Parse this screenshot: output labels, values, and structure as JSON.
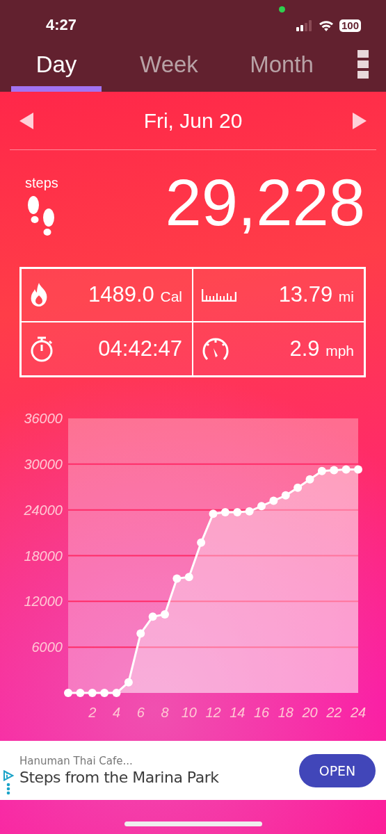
{
  "status_bar": {
    "time": "4:27",
    "battery": "100"
  },
  "tabs": [
    {
      "label": "Day",
      "selected": true
    },
    {
      "label": "Week",
      "selected": false
    },
    {
      "label": "Month",
      "selected": false
    }
  ],
  "date_nav": {
    "date": "Fri, Jun 20"
  },
  "summary": {
    "label": "steps",
    "value": "29,228"
  },
  "stats": [
    {
      "kind": "calories",
      "value": "1489.0",
      "unit": "Cal"
    },
    {
      "kind": "distance",
      "value": "13.79",
      "unit": "mi"
    },
    {
      "kind": "duration",
      "value": "04:42:47"
    },
    {
      "kind": "speed",
      "value": "2.9",
      "unit": "mph"
    }
  ],
  "chart": {
    "chart_data": {
      "type": "area",
      "x": [
        0,
        1,
        2,
        3,
        4,
        5,
        6,
        7,
        8,
        9,
        10,
        11,
        12,
        13,
        14,
        15,
        16,
        17,
        18,
        19,
        20,
        21,
        22,
        23,
        24
      ],
      "series": [
        {
          "color": "#ffffff",
          "values": [
            0,
            0,
            0,
            0,
            0,
            1400,
            7800,
            10000,
            10300,
            15000,
            15200,
            19700,
            23500,
            23700,
            23700,
            23800,
            24500,
            25200,
            25900,
            26900,
            28000,
            29100,
            29200,
            29300,
            29300
          ]
        }
      ],
      "grid": true,
      "xlim": [
        0,
        24
      ],
      "ylim": [
        0,
        36000
      ],
      "xticks": [
        2,
        4,
        6,
        8,
        10,
        12,
        14,
        16,
        18,
        20,
        22,
        24
      ],
      "yticks": [
        6000,
        12000,
        18000,
        24000,
        30000,
        36000
      ]
    }
  },
  "ad": {
    "advertiser": "Hanuman Thai Cafe...",
    "headline": "Steps from the Marina Park",
    "button": "OPEN"
  }
}
